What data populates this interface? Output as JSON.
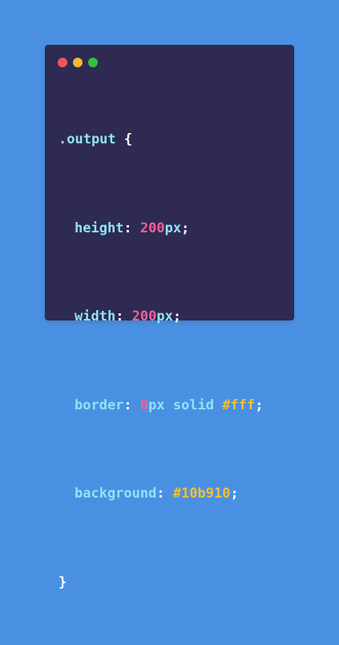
{
  "window": {
    "dots": {
      "close_color": "#f2545b",
      "minimize_color": "#f5b82e",
      "maximize_color": "#2ec43f"
    }
  },
  "code": {
    "selector": ".output",
    "open_brace": "{",
    "close_brace": "}",
    "lines": [
      {
        "property": "height",
        "number": "200",
        "rest": "px",
        "end": ";"
      },
      {
        "property": "width",
        "number": "200",
        "rest": "px",
        "end": ";"
      },
      {
        "property": "border",
        "number": "0",
        "rest": "px solid",
        "hex": "#fff",
        "end": ";"
      },
      {
        "property": "background",
        "hex": "#10b910",
        "end": ";"
      }
    ]
  }
}
